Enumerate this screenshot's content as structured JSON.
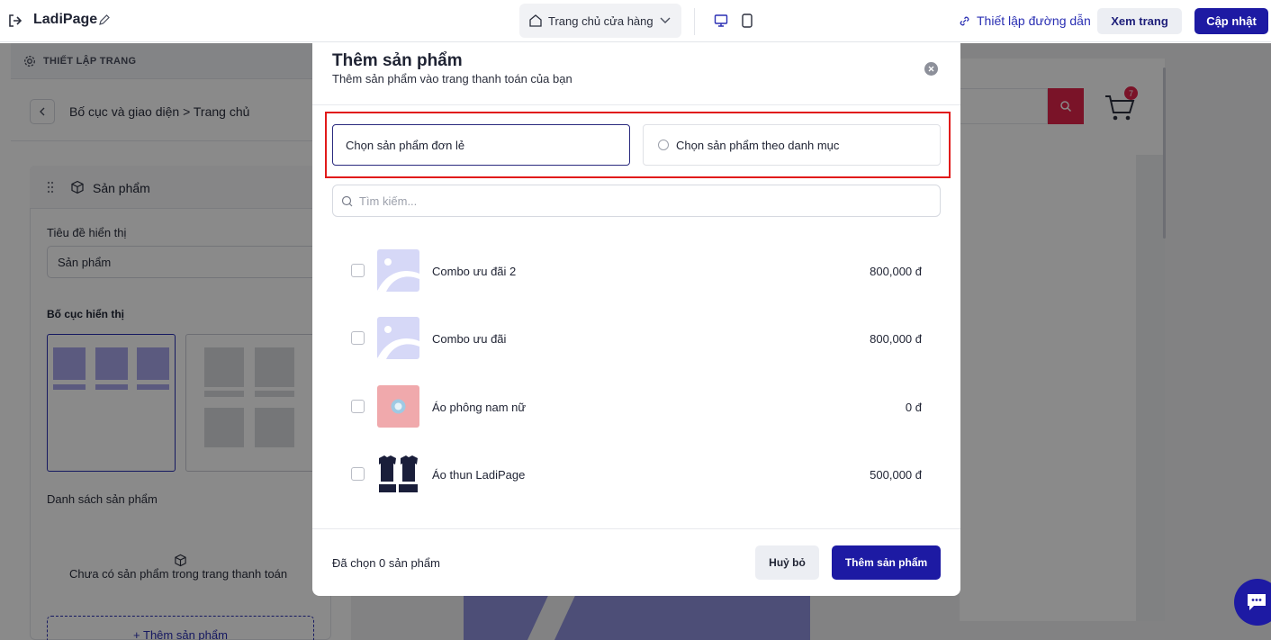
{
  "topbar": {
    "app_title": "LadiPage",
    "page_select": "Trang chủ cửa hàng",
    "link_settings": "Thiết lập đường dẫn",
    "view_label": "Xem trang",
    "update_label": "Cập nhật"
  },
  "sidebar": {
    "header": "THIẾT LẬP TRANG",
    "breadcrumb": "Bố cục và giao diện > Trang chủ",
    "section_title": "Sản phẩm",
    "display_title_label": "Tiêu đề hiển thị",
    "display_title_value": "Sản phẩm",
    "layout_label": "Bố cục hiển thị",
    "product_list_label": "Danh sách sản phẩm",
    "empty_text": "Chưa có sản phẩm trong trang thanh toán",
    "add_button": "+ Thêm sản phẩm"
  },
  "preview": {
    "cart_count": "7"
  },
  "modal": {
    "title": "Thêm sản phẩm",
    "subtitle": "Thêm sản phẩm vào trang thanh toán của bạn",
    "option_single": "Chọn sản phẩm đơn lẻ",
    "option_category": "Chọn sản phẩm theo danh mục",
    "search_placeholder": "Tìm kiếm...",
    "products": [
      {
        "name": "Combo ưu đãi 2",
        "price": "800,000 đ",
        "thumb": "placeholder-image"
      },
      {
        "name": "Combo ưu đãi",
        "price": "800,000 đ",
        "thumb": "placeholder-image"
      },
      {
        "name": "Áo phông nam nữ",
        "price": "0 đ",
        "thumb": "pink-shirt"
      },
      {
        "name": "Áo thun LadiPage",
        "price": "500,000 đ",
        "thumb": "black-tshirts"
      }
    ],
    "selected_count": "Đã chọn 0 sản phẩm",
    "cancel_label": "Huỷ bỏ",
    "add_label": "Thêm sản phẩm"
  },
  "colors": {
    "accent": "#1d1aa3",
    "highlight": "#e11a1a",
    "placeholder_thumb": "#d6d8f7"
  }
}
